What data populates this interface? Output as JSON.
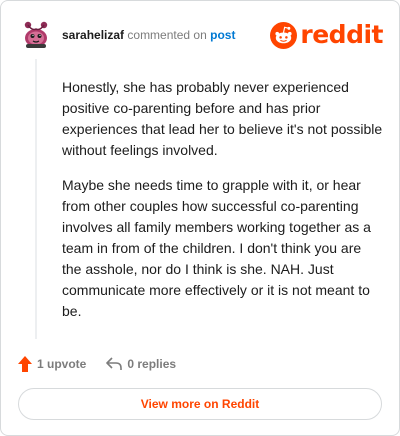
{
  "comment": {
    "username": "sarahelizaf",
    "commented_on_text": "commented on",
    "post_link_text": "post",
    "paragraphs": [
      "Honestly, she has probably never experienced positive co-parenting before and has prior experiences that lead her to believe it's not possible without feelings involved.",
      "Maybe she needs time to grapple with it, or hear from other couples how successful co-parenting involves all family members working together as a team in from of the children. I don't think you are the asshole, nor do I think is she. NAH. Just communicate more effectively or it is not meant to be."
    ]
  },
  "logo": {
    "wordmark": "reddit"
  },
  "actions": {
    "upvote_label": "1 upvote",
    "replies_label": "0 replies"
  },
  "footer": {
    "view_more_label": "View more on Reddit"
  },
  "colors": {
    "brand": "#ff4500",
    "link": "#0079d3",
    "muted": "#7c7c7c"
  }
}
